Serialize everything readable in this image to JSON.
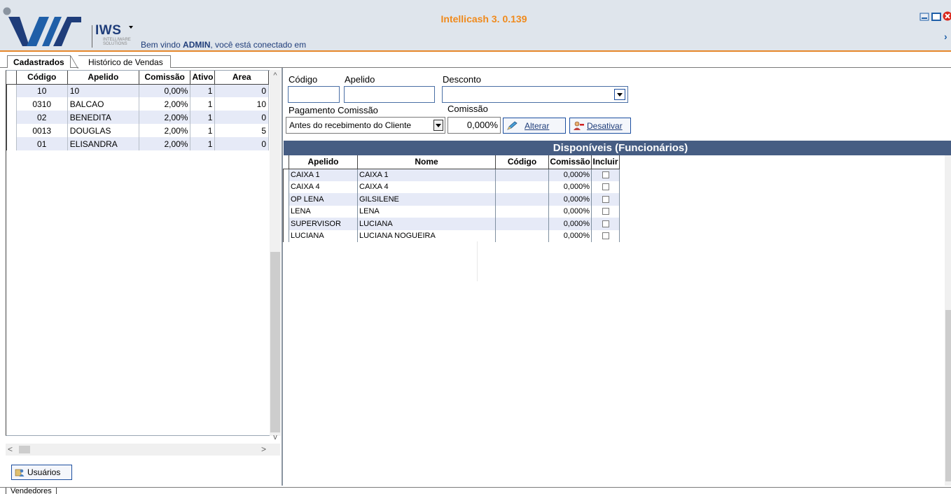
{
  "header": {
    "brand": "IWS",
    "brand_sub": "INTELLIWARE SOLUTIONS",
    "welcome_prefix": "Bem vindo ",
    "welcome_user": "ADMIN",
    "welcome_suffix": ", você está conectado em",
    "app_title": "Intellicash 3. 0.139"
  },
  "tabs": {
    "cadastrados": "Cadastrados",
    "historico": "Histórico de Vendas"
  },
  "left_table": {
    "columns": [
      "Código",
      "Apelido",
      "Comissão",
      "Ativo",
      "Area"
    ],
    "rows": [
      {
        "codigo": "10",
        "apelido": "10",
        "comissao": "0,00%",
        "ativo": "1",
        "area": "0"
      },
      {
        "codigo": "0310",
        "apelido": "BALCAO",
        "comissao": "2,00%",
        "ativo": "1",
        "area": "10"
      },
      {
        "codigo": "02",
        "apelido": "BENEDITA",
        "comissao": "2,00%",
        "ativo": "1",
        "area": "0"
      },
      {
        "codigo": "0013",
        "apelido": "DOUGLAS",
        "comissao": "2,00%",
        "ativo": "1",
        "area": "5"
      },
      {
        "codigo": "01",
        "apelido": "ELISANDRA",
        "comissao": "2,00%",
        "ativo": "1",
        "area": "0"
      }
    ]
  },
  "form": {
    "codigo_label": "Código",
    "apelido_label": "Apelido",
    "desconto_label": "Desconto",
    "pagamento_label": "Pagamento Comissão",
    "pagamento_value": "Antes do recebimento do Cliente",
    "comissao_label": "Comissão",
    "comissao_value": "0,000%",
    "alterar_button": "Alterar",
    "desativar_button": "Desativar"
  },
  "disponiveis": {
    "title": "Disponíveis (Funcionários)",
    "columns": [
      "Apelido",
      "Nome",
      "Código",
      "Comissão",
      "Incluir"
    ],
    "rows": [
      {
        "apelido": "CAIXA 1",
        "nome": "CAIXA 1",
        "codigo": "",
        "comissao": "0,000%"
      },
      {
        "apelido": "CAIXA 4",
        "nome": "CAIXA 4",
        "codigo": "",
        "comissao": "0,000%"
      },
      {
        "apelido": "OP LENA",
        "nome": "GILSILENE",
        "codigo": "",
        "comissao": "0,000%"
      },
      {
        "apelido": "LENA",
        "nome": "LENA",
        "codigo": "",
        "comissao": "0,000%"
      },
      {
        "apelido": "SUPERVISOR",
        "nome": "LUCIANA",
        "codigo": "",
        "comissao": "0,000%"
      },
      {
        "apelido": "LUCIANA",
        "nome": "LUCIANA NOGUEIRA",
        "codigo": "",
        "comissao": "0,000%"
      }
    ]
  },
  "usuarios_button": "Usuários",
  "bottom_tab": "Vendedores",
  "icons": {
    "minimize": "minimize-icon",
    "maximize": "maximize-icon",
    "close": "close-icon",
    "pencil": "pencil-icon",
    "user_remove": "user-remove-icon",
    "users": "users-icon"
  },
  "colors": {
    "title_accent": "#f08a1c",
    "section_header": "#465d83",
    "row_alt": "#e6eaf7",
    "brand": "#1f3d7a"
  }
}
